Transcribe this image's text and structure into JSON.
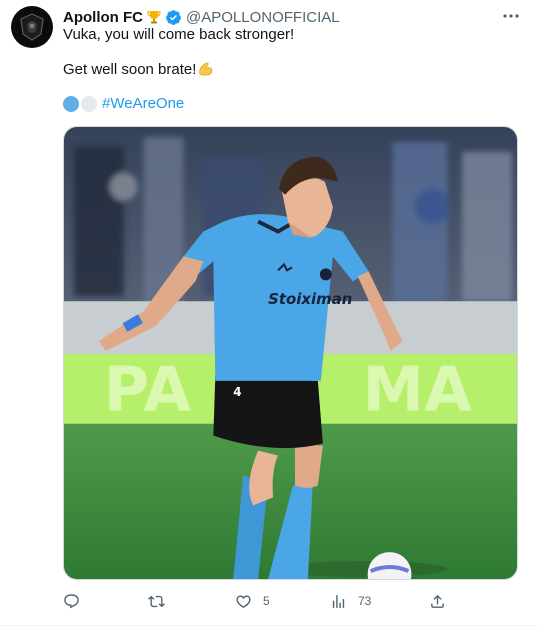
{
  "account": {
    "name": "Apollon FC",
    "handle": "@APOLLONOFFICIAL",
    "avatar_icon": "club-crest-icon",
    "badge_icon": "trophy-icon",
    "verified_icon": "verified-badge-icon",
    "verified_color": "#1d9bf0"
  },
  "tweet": {
    "line1": "Vuka, you will come back stronger!",
    "line2": "Get well soon brate!",
    "line2_emoji": "flexed-biceps-icon",
    "hashtag": "#WeAreOne",
    "hashtag_hearts": [
      "blue-heart-icon",
      "white-heart-icon"
    ],
    "hashtag_color": "#1d9bf0",
    "more_icon": "more-icon"
  },
  "media": {
    "kit_color": "#4aa6e6",
    "kit_sponsor": "Stoiximan",
    "kit_maker": "puma",
    "board_text": "PA MA",
    "board_color": "#9ef548",
    "pitch_color": "#3a8a3a"
  },
  "actions": {
    "reply": {
      "icon": "reply-icon",
      "count": ""
    },
    "retweet": {
      "icon": "retweet-icon",
      "count": ""
    },
    "like": {
      "icon": "heart-icon",
      "count": "5"
    },
    "views": {
      "icon": "views-icon",
      "count": "73"
    },
    "share": {
      "icon": "share-icon",
      "count": ""
    }
  }
}
